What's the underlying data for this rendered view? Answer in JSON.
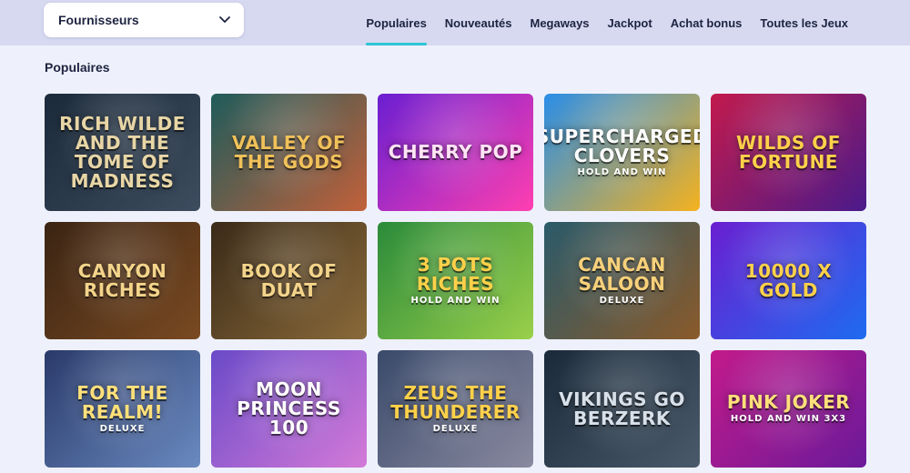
{
  "header": {
    "provider_select": {
      "label": "Fournisseurs",
      "icon": "chevron-down-icon"
    },
    "tabs": [
      {
        "label": "Populaires",
        "active": true
      },
      {
        "label": "Nouveautés",
        "active": false
      },
      {
        "label": "Megaways",
        "active": false
      },
      {
        "label": "Jackpot",
        "active": false
      },
      {
        "label": "Achat bonus",
        "active": false
      },
      {
        "label": "Toutes les Jeux",
        "active": false
      }
    ],
    "accent": "#2ec4d6"
  },
  "section": {
    "title": "Populaires"
  },
  "games": [
    {
      "title": "Rich Wilde and the Tome of Madness",
      "art": "dark-library",
      "bg": [
        "#1b2a3a",
        "#3d4c5e"
      ],
      "fg": "#e8d6a6"
    },
    {
      "title": "Valley of the Gods",
      "art": "egypt-sunset",
      "bg": [
        "#1f5c5b",
        "#c2603a"
      ],
      "fg": "#f0c15a"
    },
    {
      "title": "Cherry Pop",
      "art": "neon-candy",
      "bg": [
        "#6a1fd1",
        "#ff3fb0"
      ],
      "fg": "#ffe4f5"
    },
    {
      "title": "Supercharged Clovers",
      "sub": "Hold and Win",
      "art": "gold-flower-sky",
      "bg": [
        "#2a8ee8",
        "#f5b21e"
      ],
      "fg": "#ffffff"
    },
    {
      "title": "Wilds of Fortune",
      "art": "casino-stage",
      "bg": [
        "#c21a4c",
        "#4a1a8a"
      ],
      "fg": "#ffd14a"
    },
    {
      "title": "Canyon Riches",
      "art": "miner-cave",
      "bg": [
        "#3a2413",
        "#7a4a22"
      ],
      "fg": "#f3d48a"
    },
    {
      "title": "Book of Duat",
      "art": "golden-scarab",
      "bg": [
        "#3a2a18",
        "#8a6a3a"
      ],
      "fg": "#f3d48a"
    },
    {
      "title": "3 Pots Riches",
      "sub": "Hold and Win",
      "art": "leprechaun-meadow",
      "bg": [
        "#2a8a3a",
        "#9ad04a"
      ],
      "fg": "#ffd14a"
    },
    {
      "title": "Cancan Saloon",
      "sub": "Deluxe",
      "art": "western-saloon",
      "bg": [
        "#2a5a6a",
        "#8a5a2a"
      ],
      "fg": "#f7d07a"
    },
    {
      "title": "10000 X Gold",
      "art": "neon-blue-x",
      "bg": [
        "#6a1fd1",
        "#1e6bf0"
      ],
      "fg": "#ffd14a"
    },
    {
      "title": "For the Realm!",
      "sub": "Deluxe",
      "art": "medieval-castle",
      "bg": [
        "#2a3a6a",
        "#6a8ac0"
      ],
      "fg": "#ffe07a"
    },
    {
      "title": "Moon Princess 100",
      "art": "purple-sky",
      "bg": [
        "#6a4ac8",
        "#d47ad8"
      ],
      "fg": "#ffffff"
    },
    {
      "title": "Zeus the Thunderer",
      "sub": "Deluxe",
      "art": "stone-god",
      "bg": [
        "#3a4a6a",
        "#8a8aa0"
      ],
      "fg": "#ffd14a"
    },
    {
      "title": "Vikings Go Berzerk",
      "art": "dark-steel",
      "bg": [
        "#1a2a3a",
        "#4a5a6a"
      ],
      "fg": "#d8e0ea"
    },
    {
      "title": "Pink Joker",
      "sub": "Hold and Win 3x3",
      "art": "pink-lightning",
      "bg": [
        "#c21a8a",
        "#6a1a9a"
      ],
      "fg": "#ffe07a"
    }
  ]
}
